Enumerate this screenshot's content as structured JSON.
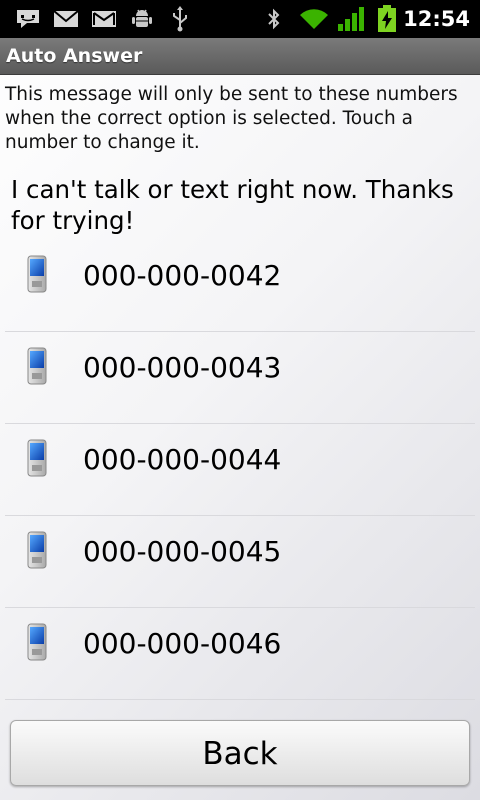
{
  "status_bar": {
    "time": "12:54",
    "left_icons": [
      "sms-icon",
      "gmail-icon",
      "email-icon",
      "android-debug-icon",
      "usb-icon"
    ],
    "right_icons": [
      "bluetooth-icon",
      "wifi-icon",
      "signal-icon",
      "battery-charging-icon"
    ]
  },
  "title": "Auto Answer",
  "info": "This message will only be sent to these numbers when the correct option is selected. Touch a number to change it.",
  "message": "I can't talk or text right now. Thanks for trying!",
  "numbers": [
    {
      "label": "000-000-0042",
      "icon": "mobile-phone-icon"
    },
    {
      "label": "000-000-0043",
      "icon": "mobile-phone-icon"
    },
    {
      "label": "000-000-0044",
      "icon": "mobile-phone-icon"
    },
    {
      "label": "000-000-0045",
      "icon": "mobile-phone-icon"
    },
    {
      "label": "000-000-0046",
      "icon": "mobile-phone-icon"
    }
  ],
  "back_label": "Back",
  "colors": {
    "status_bar_bg": "#000000",
    "title_bar_bg": "#666666",
    "wifi_green": "#3bb300",
    "battery_green": "#7ed321"
  }
}
